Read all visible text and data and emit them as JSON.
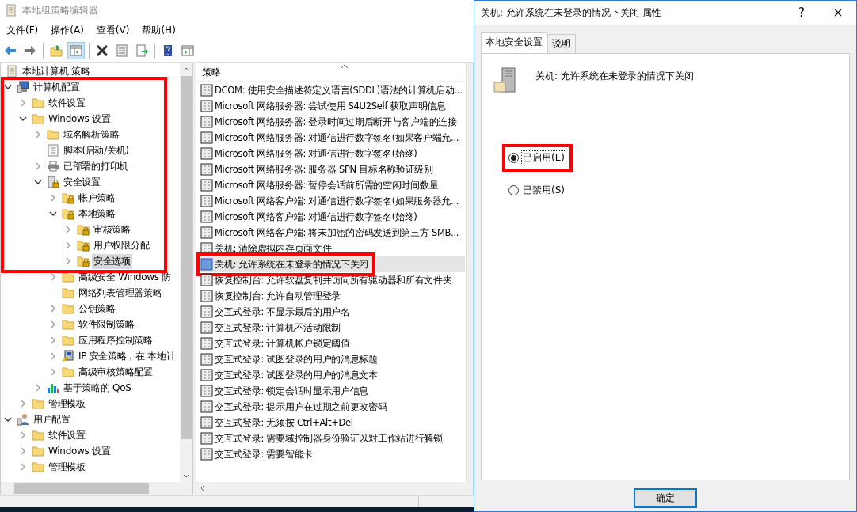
{
  "window": {
    "title": "本地组策略编辑器"
  },
  "menu": [
    "文件(F)",
    "操作(A)",
    "查看(V)",
    "帮助(H)"
  ],
  "toolbar": [
    {
      "pressed": false
    },
    {
      "pressed": false
    },
    {
      "pressed": false
    },
    {
      "pressed": true
    },
    {
      "pressed": false
    },
    {
      "pressed": false
    },
    {
      "pressed": false
    },
    {
      "pressed": false
    },
    {
      "pressed": false
    }
  ],
  "tree": {
    "highlighted": true,
    "items": [
      {
        "label": "本地计算机 策略",
        "kind": "policy",
        "selected": false,
        "children": [
          {
            "label": "计算机配置",
            "kind": "computer",
            "selected": false,
            "expanded": true,
            "children": [
              {
                "label": "软件设置",
                "kind": "folder",
                "selected": false,
                "expanded": false
              },
              {
                "label": "Windows 设置",
                "kind": "folder",
                "selected": false,
                "expanded": true,
                "children": [
                  {
                    "label": "域名解析策略",
                    "kind": "folder",
                    "selected": false,
                    "expanded": false
                  },
                  {
                    "label": "脚本(启动/关机)",
                    "kind": "script",
                    "selected": false
                  },
                  {
                    "label": "已部署的打印机",
                    "kind": "printer",
                    "selected": false,
                    "expanded": false
                  },
                  {
                    "label": "安全设置",
                    "kind": "security",
                    "selected": false,
                    "expanded": true,
                    "children": [
                      {
                        "label": "帐户策略",
                        "kind": "lock-folder",
                        "selected": false,
                        "expanded": false
                      },
                      {
                        "label": "本地策略",
                        "kind": "lock-folder",
                        "selected": false,
                        "expanded": true,
                        "children": [
                          {
                            "label": "审核策略",
                            "kind": "lock-folder",
                            "selected": false,
                            "expanded": false
                          },
                          {
                            "label": "用户权限分配",
                            "kind": "lock-folder",
                            "selected": false,
                            "expanded": false
                          },
                          {
                            "label": "安全选项",
                            "kind": "lock-folder",
                            "selected": true,
                            "expanded": false
                          }
                        ]
                      },
                      {
                        "label": "高级安全 Windows 防",
                        "kind": "folder",
                        "selected": false,
                        "expanded": false
                      },
                      {
                        "label": "网络列表管理器策略",
                        "kind": "folder",
                        "selected": false
                      },
                      {
                        "label": "公钥策略",
                        "kind": "folder",
                        "selected": false,
                        "expanded": false
                      },
                      {
                        "label": "软件限制策略",
                        "kind": "folder",
                        "selected": false,
                        "expanded": false
                      },
                      {
                        "label": "应用程序控制策略",
                        "kind": "folder",
                        "selected": false,
                        "expanded": false
                      },
                      {
                        "label": "IP 安全策略，在 本地计",
                        "kind": "ipsec",
                        "selected": false,
                        "expanded": false
                      },
                      {
                        "label": "高级审核策略配置",
                        "kind": "folder",
                        "selected": false,
                        "expanded": false
                      }
                    ]
                  },
                  {
                    "label": "基于策略的 QoS",
                    "kind": "chart",
                    "selected": false,
                    "expanded": false
                  }
                ]
              },
              {
                "label": "管理模板",
                "kind": "folder",
                "selected": false,
                "expanded": false
              }
            ]
          },
          {
            "label": "用户配置",
            "kind": "user",
            "selected": false,
            "expanded": true,
            "children": [
              {
                "label": "软件设置",
                "kind": "folder",
                "selected": false,
                "expanded": false
              },
              {
                "label": "Windows 设置",
                "kind": "folder",
                "selected": false,
                "expanded": false
              },
              {
                "label": "管理模板",
                "kind": "folder",
                "selected": false,
                "expanded": false
              }
            ]
          }
        ]
      }
    ]
  },
  "list": {
    "column": "策略",
    "rows": [
      {
        "label": "DCOM: 使用安全描述符定义语言(SDDL)语法的计算机启动...",
        "selected": false,
        "highlighted": false
      },
      {
        "label": "Microsoft 网络服务器: 尝试使用 S4U2Self 获取声明信息",
        "selected": false,
        "highlighted": false
      },
      {
        "label": "Microsoft 网络服务器: 登录时间过期后断开与客户端的连接",
        "selected": false,
        "highlighted": false
      },
      {
        "label": "Microsoft 网络服务器: 对通信进行数字签名(如果客户端允...",
        "selected": false,
        "highlighted": false
      },
      {
        "label": "Microsoft 网络服务器: 对通信进行数字签名(始终)",
        "selected": false,
        "highlighted": false
      },
      {
        "label": "Microsoft 网络服务器: 服务器 SPN 目标名称验证级别",
        "selected": false,
        "highlighted": false
      },
      {
        "label": "Microsoft 网络服务器: 暂停会话前所需的空闲时间数量",
        "selected": false,
        "highlighted": false
      },
      {
        "label": "Microsoft 网络客户端: 对通信进行数字签名(如果服务器允...",
        "selected": false,
        "highlighted": false
      },
      {
        "label": "Microsoft 网络客户端: 对通信进行数字签名(始终)",
        "selected": false,
        "highlighted": false
      },
      {
        "label": "Microsoft 网络客户端: 将未加密的密码发送到第三方 SMB...",
        "selected": false,
        "highlighted": false
      },
      {
        "label": "关机: 清除虚拟内存页面文件",
        "selected": false,
        "highlighted": false
      },
      {
        "label": "关机: 允许系统在未登录的情况下关闭",
        "selected": true,
        "highlighted": true
      },
      {
        "label": "恢复控制台: 允许软盘复制并访问所有驱动器和所有文件夹",
        "selected": false,
        "highlighted": false
      },
      {
        "label": "恢复控制台: 允许自动管理登录",
        "selected": false,
        "highlighted": false
      },
      {
        "label": "交互式登录: 不显示最后的用户名",
        "selected": false,
        "highlighted": false
      },
      {
        "label": "交互式登录: 计算机不活动限制",
        "selected": false,
        "highlighted": false
      },
      {
        "label": "交互式登录: 计算机帐户锁定阈值",
        "selected": false,
        "highlighted": false
      },
      {
        "label": "交互式登录: 试图登录的用户的消息标题",
        "selected": false,
        "highlighted": false
      },
      {
        "label": "交互式登录: 试图登录的用户的消息文本",
        "selected": false,
        "highlighted": false
      },
      {
        "label": "交互式登录: 锁定会话时显示用户信息",
        "selected": false,
        "highlighted": false
      },
      {
        "label": "交互式登录: 提示用户在过期之前更改密码",
        "selected": false,
        "highlighted": false
      },
      {
        "label": "交互式登录: 无须按 Ctrl+Alt+Del",
        "selected": false,
        "highlighted": false
      },
      {
        "label": "交互式登录: 需要域控制器身份验证以对工作站进行解锁",
        "selected": false,
        "highlighted": false
      },
      {
        "label": "交互式登录: 需要智能卡",
        "selected": false,
        "highlighted": false
      }
    ]
  },
  "dialog": {
    "title": "关机: 允许系统在未登录的情况下关闭 属性",
    "help": "?",
    "close": "×",
    "tabs": [
      {
        "label": "本地安全设置",
        "selected": true
      },
      {
        "label": "说明",
        "selected": false
      }
    ],
    "policy_name": "关机: 允许系统在未登录的情况下关闭",
    "options": [
      {
        "label": "已启用(E)",
        "selected": true,
        "highlighted": true
      },
      {
        "label": "已禁用(S)",
        "selected": false,
        "highlighted": false
      }
    ],
    "buttons": [
      "确定"
    ]
  }
}
